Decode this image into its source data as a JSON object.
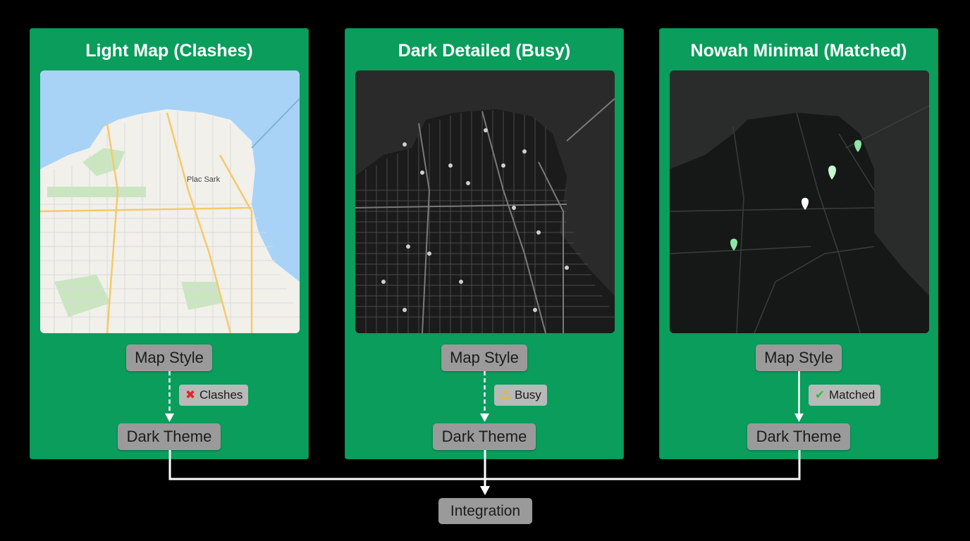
{
  "panels": [
    {
      "title": "Light Map (Clashes)",
      "map_labels": {
        "place": "Plac Sark"
      },
      "style_label": "Map Style",
      "theme_label": "Dark Theme",
      "badge": {
        "icon": "cross-mark-icon",
        "icon_char": "✖",
        "icon_color": "#e0262b",
        "label": "Clashes"
      },
      "connector": "dashed"
    },
    {
      "title": "Dark Detailed (Busy)",
      "style_label": "Map Style",
      "theme_label": "Dark Theme",
      "badge": {
        "icon": "warning-icon",
        "icon_char": "⚠",
        "icon_color": "#f2b705",
        "label": "Busy"
      },
      "connector": "dashed"
    },
    {
      "title": "Nowah Minimal (Matched)",
      "style_label": "Map Style",
      "theme_label": "Dark Theme",
      "badge": {
        "icon": "check-mark-icon",
        "icon_char": "✔",
        "icon_color": "#2fbf3a",
        "label": "Matched"
      },
      "connector": "solid"
    }
  ],
  "integration_label": "Integration",
  "colors": {
    "panel_green": "#0a9d5c",
    "pill_gray": "#9a9a9a",
    "badge_gray": "#b9b9b9",
    "background": "#000000",
    "water_light": "#a8d3f7",
    "land_light": "#f2f0eb",
    "dark_map": "#1f1f1f",
    "minimal_map": "#1b1e1d",
    "pin_green": "#8ee6a4"
  }
}
